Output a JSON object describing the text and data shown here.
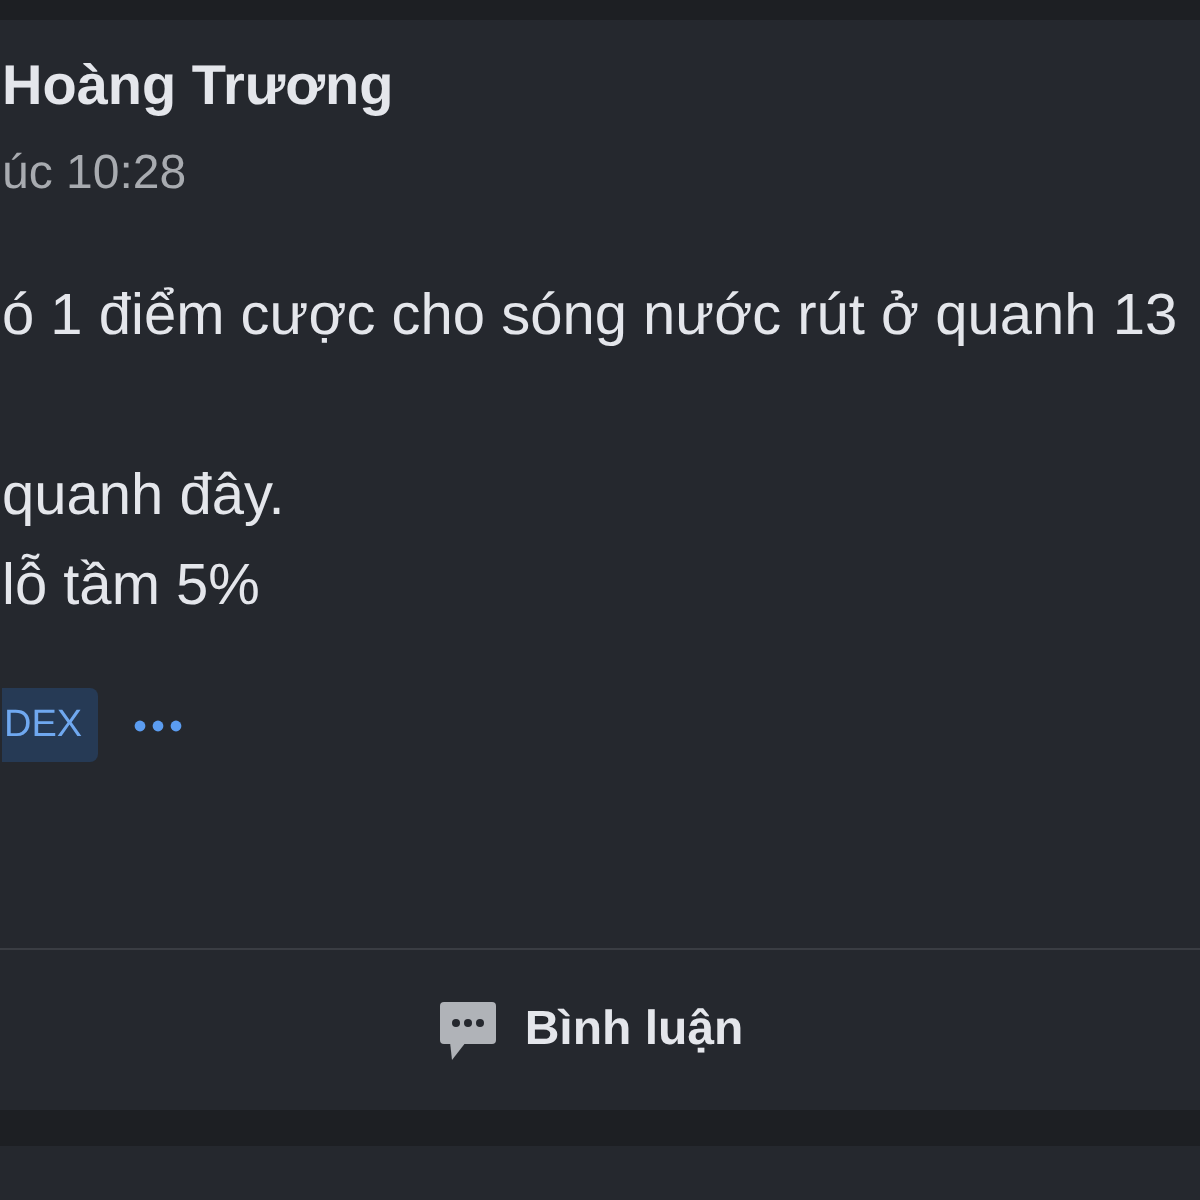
{
  "post": {
    "author": "Hoàng Trương",
    "time": "úc 10:28",
    "paragraphs": [
      [
        "ó 1 điểm cược cho sóng nước rút ở quanh 13"
      ],
      [
        "quanh đây.",
        "lỗ tầm 5%"
      ]
    ],
    "tags": [
      "DEX"
    ]
  },
  "actions": [
    {
      "kind": "comment",
      "label": "Bình luận"
    }
  ]
}
